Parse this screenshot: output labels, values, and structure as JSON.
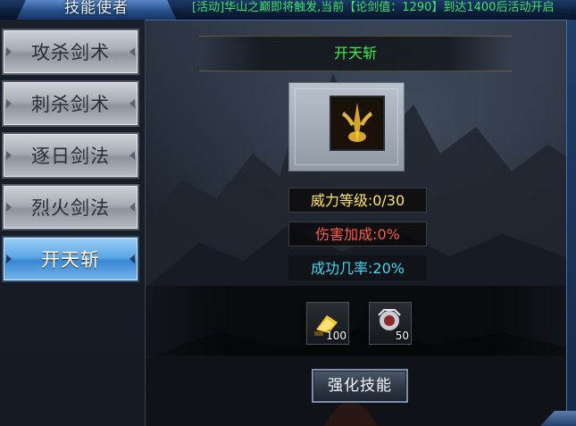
{
  "window": {
    "title": "技能使者",
    "marquee": "[活动]华山之巅即将触发,当前【论剑值：1290】到达1400后活动开启"
  },
  "sidebar": {
    "items": [
      {
        "label": "攻杀剑术"
      },
      {
        "label": "刺杀剑术"
      },
      {
        "label": "逐日剑法"
      },
      {
        "label": "烈火剑法"
      },
      {
        "label": "开天斩",
        "active": true
      }
    ]
  },
  "skill": {
    "name": "开天斩",
    "icon": "sword-flame-icon",
    "stats": {
      "power": "威力等级:0/30",
      "damage": "伤害加成:0%",
      "success": "成功几率:20%"
    }
  },
  "materials": [
    {
      "icon": "gold-ingot-icon",
      "qty": "100"
    },
    {
      "icon": "gem-icon",
      "qty": "50"
    }
  ],
  "actions": {
    "enhance_label": "强化技能"
  },
  "colors": {
    "skill_name": "#3af04a",
    "power": "#ffe36a",
    "damage": "#ff5a4a",
    "success": "#41d6f2",
    "marquee": "#3fe06a"
  }
}
